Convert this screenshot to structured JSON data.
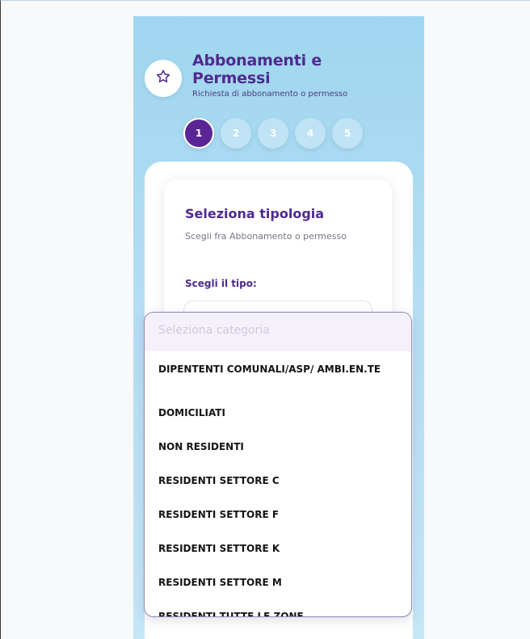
{
  "header": {
    "icon": "star-icon",
    "title_line1": "Abbonamenti e",
    "title_line2": "Permessi",
    "subtitle": "Richiesta di abbonamento o permesso"
  },
  "steps": [
    {
      "label": "1",
      "active": true
    },
    {
      "label": "2",
      "active": false
    },
    {
      "label": "3",
      "active": false
    },
    {
      "label": "4",
      "active": false
    },
    {
      "label": "5",
      "active": false
    }
  ],
  "card": {
    "title": "Seleziona tipologia",
    "description": "Scegli fra Abbonamento o permesso",
    "type_label": "Scegli il tipo:"
  },
  "dropdown": {
    "placeholder": "Seleziona categoria",
    "options": [
      "DIPENTENTI COMUNALI/ASP/ AMBI.EN.TE",
      "DOMICILIATI",
      "NON RESIDENTI",
      "RESIDENTI SETTORE C",
      "RESIDENTI SETTORE F",
      "RESIDENTI SETTORE K",
      "RESIDENTI SETTORE M",
      "RESIDENTI TUTTE LE ZONE"
    ]
  },
  "colors": {
    "primary": "#5b2595",
    "title": "#4e2a8e",
    "background_top": "#9fd6ef",
    "background_bottom": "#c5e6f6"
  }
}
